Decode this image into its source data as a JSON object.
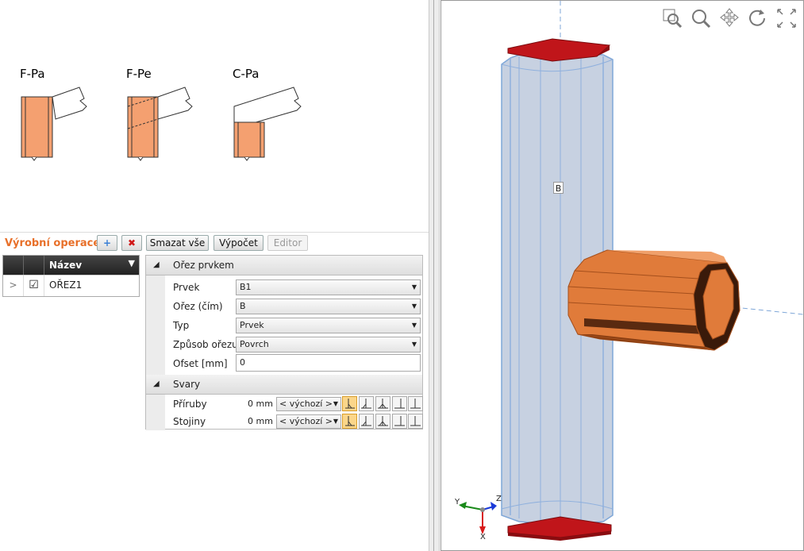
{
  "sketches": [
    {
      "label": "F-Pa"
    },
    {
      "label": "F-Pe"
    },
    {
      "label": "C-Pa"
    }
  ],
  "operations": {
    "title": "Výrobní operace",
    "buttons": {
      "add": "+",
      "remove": "✖",
      "delete_all": "Smazat vše",
      "calculate": "Výpočet",
      "editor": "Editor"
    },
    "grid": {
      "header_name": "Název",
      "rows": [
        {
          "expander": ">",
          "checked": "☑",
          "name": "OŘEZ1"
        }
      ]
    }
  },
  "properties": {
    "cut": {
      "title": "Ořez prvkem",
      "collapse_glyph": "◢",
      "fields": [
        {
          "label": "Prvek",
          "value": "B1"
        },
        {
          "label": "Ořez (čím)",
          "value": "B"
        },
        {
          "label": "Typ",
          "value": "Prvek"
        },
        {
          "label": "Způsob ořezu",
          "value": "Povrch"
        },
        {
          "label": "Ofset [mm]",
          "value": "0"
        }
      ]
    },
    "welds": {
      "title": "Svary",
      "collapse_glyph": "◢",
      "rows": [
        {
          "label": "Příruby",
          "size": "0 mm",
          "type": "< výchozí >"
        },
        {
          "label": "Stojiny",
          "size": "0 mm",
          "type": "< výchozí >"
        }
      ]
    }
  },
  "viewport": {
    "member_label": "B",
    "axes": {
      "y": "Y",
      "z": "Z",
      "x": "X"
    },
    "colors": {
      "column": "#b9c6d9",
      "beam": "#e07b3a",
      "plate": "#c0151a"
    }
  }
}
